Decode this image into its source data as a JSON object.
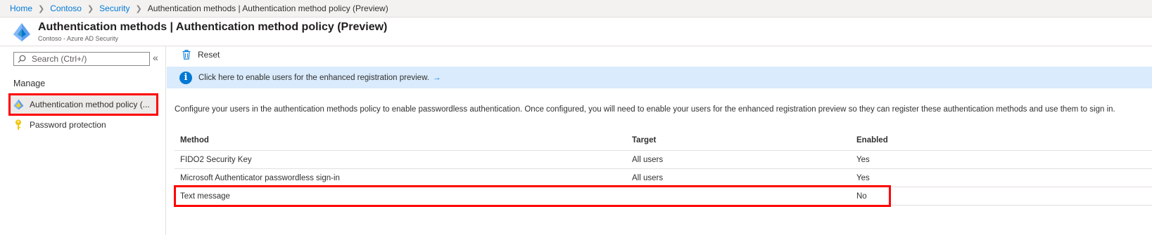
{
  "breadcrumb": {
    "items": [
      "Home",
      "Contoso",
      "Security"
    ],
    "current": "Authentication methods | Authentication method policy (Preview)",
    "separator_icon": "chevron-right-icon"
  },
  "header": {
    "title": "Authentication methods | Authentication method policy (Preview)",
    "subtitle": "Contoso - Azure AD Security",
    "icon": "azure-ad-pyramid-icon"
  },
  "sidebar": {
    "search_placeholder": "Search (Ctrl+/)",
    "collapse_label": "«",
    "section": "Manage",
    "items": [
      {
        "label": "Authentication method policy (...",
        "icon": "azure-ad-pyramid-icon",
        "selected": true
      },
      {
        "label": "Password protection",
        "icon": "key-icon",
        "selected": false
      }
    ]
  },
  "toolbar": {
    "reset_label": "Reset",
    "reset_icon": "trash-icon"
  },
  "info_bar": {
    "text": "Click here to enable users for the enhanced registration preview.",
    "arrow": "→",
    "icon": "info-icon"
  },
  "main": {
    "description": "Configure your users in the authentication methods policy to enable passwordless authentication. Once configured, you will need to enable your users for the enhanced registration preview so they can register these authentication methods and use them to sign in."
  },
  "table": {
    "columns": [
      "Method",
      "Target",
      "Enabled"
    ],
    "rows": [
      {
        "method": "FIDO2 Security Key",
        "target": "All users",
        "enabled": "Yes"
      },
      {
        "method": "Microsoft Authenticator passwordless sign-in",
        "target": "All users",
        "enabled": "Yes"
      },
      {
        "method": "Text message",
        "target": "",
        "enabled": "No"
      }
    ]
  },
  "colors": {
    "accent": "#0078d4",
    "highlight": "#ff0000",
    "info_background": "#d9ebfc"
  }
}
